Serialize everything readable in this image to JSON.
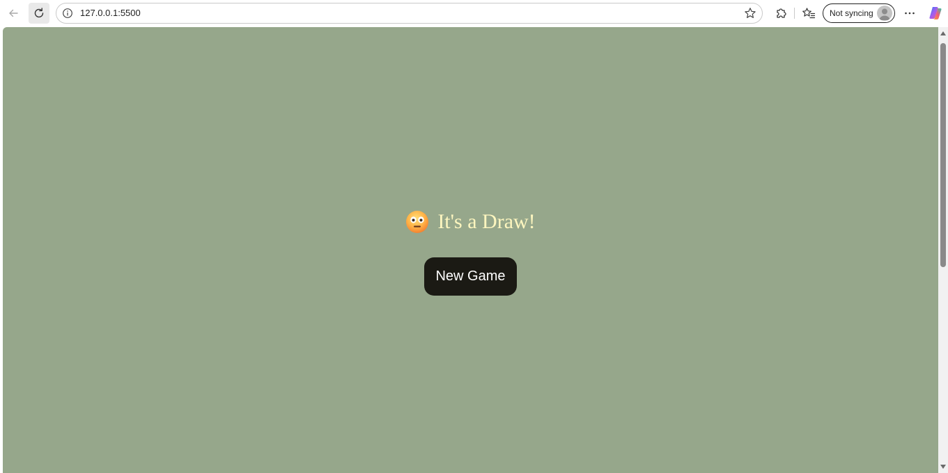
{
  "browser": {
    "url": "127.0.0.1:5500",
    "profile_label": "Not syncing",
    "icons": {
      "back": "back-arrow-icon",
      "reload": "reload-icon",
      "info": "info-icon",
      "favorite": "star-icon",
      "extensions": "puzzle-icon",
      "favorites": "favorites-icon",
      "avatar": "avatar-icon",
      "more": "more-icon",
      "copilot": "copilot-icon"
    }
  },
  "game": {
    "result_text": "It's a Draw!",
    "result_emoji": "neutral-face-emoji",
    "new_game_label": "New Game"
  },
  "colors": {
    "page_background": "#96a78b",
    "result_text": "#fdf6bf",
    "button_background": "#1b1a14",
    "button_text": "#ffffff"
  }
}
